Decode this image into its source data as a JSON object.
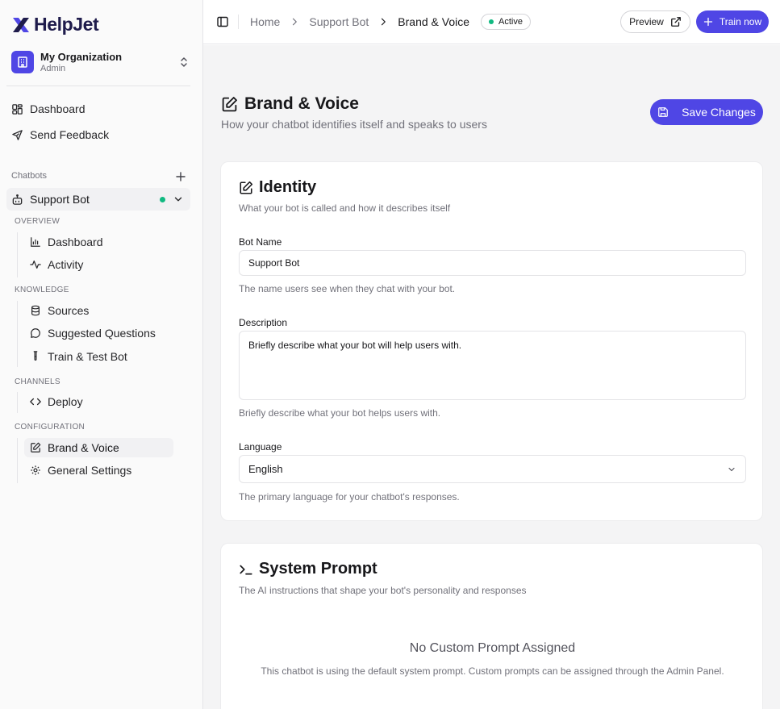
{
  "brand": {
    "name": "HelpJet",
    "accent": "#4f46e5",
    "active_color": "#10b981"
  },
  "org": {
    "name": "My Organization",
    "role": "Admin"
  },
  "nav": {
    "dashboard": "Dashboard",
    "feedback": "Send Feedback"
  },
  "chatbots": {
    "label": "Chatbots",
    "bot_name": "Support Bot",
    "sections": {
      "overview": "OVERVIEW",
      "knowledge": "KNOWLEDGE",
      "channels": "CHANNELS",
      "configuration": "CONFIGURATION"
    },
    "items": {
      "dashboard": "Dashboard",
      "activity": "Activity",
      "sources": "Sources",
      "suggested": "Suggested Questions",
      "train": "Train & Test Bot",
      "deploy": "Deploy",
      "brand": "Brand & Voice",
      "general": "General Settings"
    }
  },
  "header": {
    "crumbs": [
      "Home",
      "Support Bot",
      "Brand & Voice"
    ],
    "badge": "Active",
    "preview": "Preview",
    "train": "Train now"
  },
  "page": {
    "title": "Brand & Voice",
    "subtitle": "How your chatbot identifies itself and speaks to users",
    "save": "Save Changes"
  },
  "identity": {
    "title": "Identity",
    "subtitle": "What your bot is called and how it describes itself",
    "bot_name_label": "Bot Name",
    "bot_name_value": "Support Bot",
    "bot_name_help": "The name users see when they chat with your bot.",
    "description_label": "Description",
    "description_placeholder": "Briefly describe what your bot will help users with.",
    "description_help": "Briefly describe what your bot helps users with.",
    "language_label": "Language",
    "language_value": "English",
    "language_help": "The primary language for your chatbot's responses."
  },
  "system_prompt": {
    "title": "System Prompt",
    "subtitle": "The AI instructions that shape your bot's personality and responses",
    "empty_title": "No Custom Prompt Assigned",
    "empty_text": "This chatbot is using the default system prompt. Custom prompts can be assigned through the Admin Panel."
  }
}
